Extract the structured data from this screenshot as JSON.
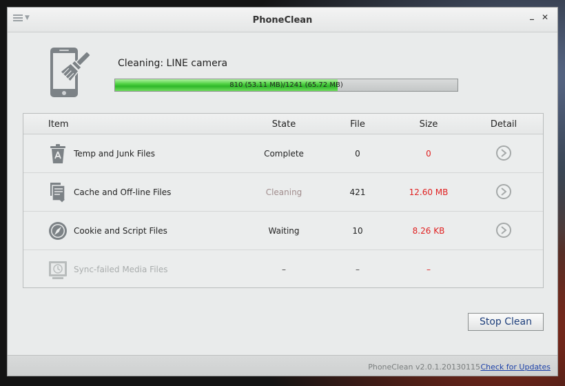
{
  "window": {
    "title": "PhoneClean"
  },
  "cleaning": {
    "label": "Cleaning: LINE camera",
    "progress_text": "810 (53.11 MB)/1241 (65.72 MB)",
    "progress_fraction": 0.65
  },
  "table": {
    "headers": {
      "item": "Item",
      "state": "State",
      "file": "File",
      "size": "Size",
      "detail": "Detail"
    },
    "rows": [
      {
        "icon": "trash-icon",
        "name": "Temp and Junk Files",
        "state": "Complete",
        "file": "0",
        "size": "0"
      },
      {
        "icon": "document-icon",
        "name": "Cache and Off-line Files",
        "state": "Cleaning",
        "file": "421",
        "size": "12.60 MB"
      },
      {
        "icon": "compass-icon",
        "name": "Cookie and Script Files",
        "state": "Waiting",
        "file": "10",
        "size": "8.26 KB"
      },
      {
        "icon": "media-sync-icon",
        "name": "Sync-failed Media Files",
        "state": "–",
        "file": "–",
        "size": "–"
      }
    ]
  },
  "actions": {
    "stop_label": "Stop Clean"
  },
  "status": {
    "version": "PhoneClean v2.0.1.20130115",
    "updates_link": "Check for Updates"
  },
  "colors": {
    "progress_green": "#2fb72a",
    "size_red": "#e01f1f",
    "link_blue": "#1a3fa8"
  }
}
